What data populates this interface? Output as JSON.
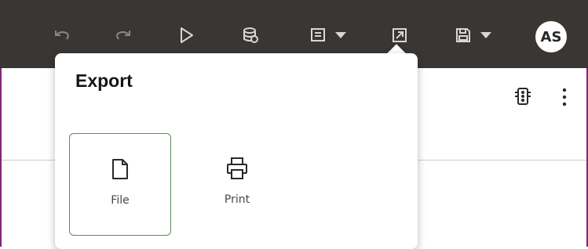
{
  "toolbar": {
    "icons": [
      "undo-icon",
      "redo-icon",
      "run-icon",
      "data-icon",
      "notes-icon",
      "export-icon",
      "save-icon"
    ],
    "avatar_initials": "AS",
    "colors": {
      "background": "#3a3633",
      "icon": "#d9d6d3",
      "accent_frame": "#7b2b6e"
    }
  },
  "header": {
    "right_icons": [
      "traffic-light-icon",
      "more-vertical-icon"
    ]
  },
  "export_popup": {
    "title": "Export",
    "options": [
      {
        "label": "File",
        "icon": "file-icon",
        "selected": true
      },
      {
        "label": "Print",
        "icon": "printer-icon",
        "selected": false
      }
    ],
    "colors": {
      "selected_border": "#5c8a5c"
    }
  }
}
